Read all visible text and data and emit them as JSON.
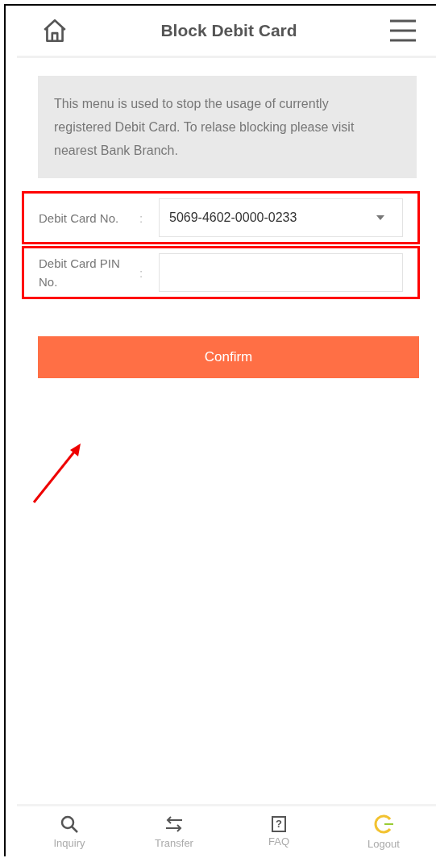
{
  "header": {
    "title": "Block Debit Card"
  },
  "info": "This menu is used to stop the usage of currently registered Debit Card. To relase blocking please visit nearest Bank Branch.",
  "fields": [
    {
      "label": "Debit Card No.",
      "separator": ":",
      "kind": "select",
      "value": "5069-4602-0000-0233",
      "highlighted": true
    },
    {
      "label": "Debit Card PIN No.",
      "separator": ":",
      "kind": "input",
      "highlighted": true
    }
  ],
  "confirm_button": "Confirm",
  "annotation_arrow": true,
  "bottom_nav": [
    {
      "kind": "search",
      "label": "Inquiry"
    },
    {
      "kind": "transfer",
      "label": "Transfer"
    },
    {
      "kind": "faq",
      "label": "FAQ",
      "glyph": "?"
    },
    {
      "kind": "logout",
      "label": "Logout"
    }
  ]
}
